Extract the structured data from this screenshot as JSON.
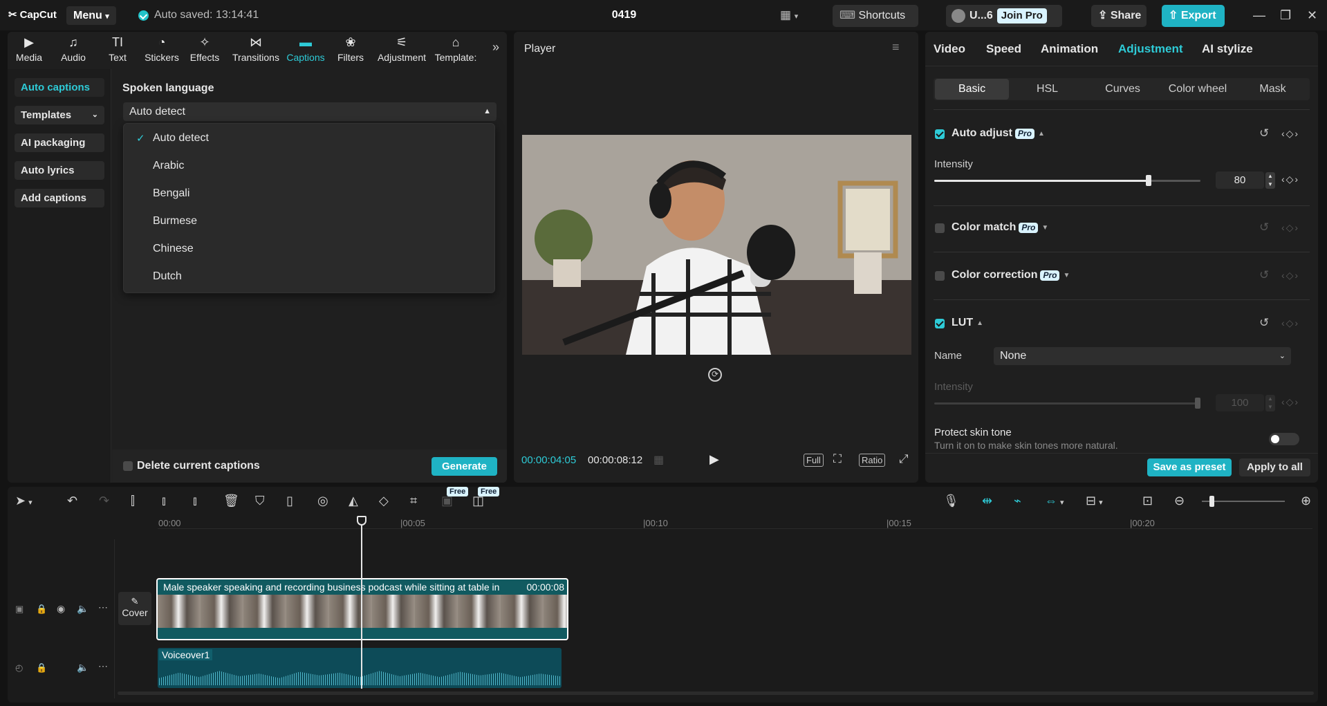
{
  "app": {
    "logo": "CapCut",
    "menu_label": "Menu",
    "autosave": "Auto saved: 13:14:41",
    "project_title": "0419"
  },
  "topbar": {
    "shortcuts": "Shortcuts",
    "user": "U...6",
    "join_pro": "Join Pro",
    "share": "Share",
    "export": "Export"
  },
  "tools": [
    {
      "label": "Media",
      "icon": "media-icon"
    },
    {
      "label": "Audio",
      "icon": "audio-icon"
    },
    {
      "label": "Text",
      "icon": "text-icon"
    },
    {
      "label": "Stickers",
      "icon": "stickers-icon"
    },
    {
      "label": "Effects",
      "icon": "effects-icon"
    },
    {
      "label": "Transitions",
      "icon": "transitions-icon"
    },
    {
      "label": "Captions",
      "icon": "captions-icon"
    },
    {
      "label": "Filters",
      "icon": "filters-icon"
    },
    {
      "label": "Adjustment",
      "icon": "adjustment-icon"
    },
    {
      "label": "Template:",
      "icon": "template-icon"
    }
  ],
  "left_nav": [
    "Auto captions",
    "Templates",
    "AI packaging",
    "Auto lyrics",
    "Add captions"
  ],
  "captions": {
    "spoken_language_label": "Spoken language",
    "selected": "Auto detect",
    "options": [
      "Auto detect",
      "Arabic",
      "Bengali",
      "Burmese",
      "Chinese",
      "Dutch"
    ],
    "delete_label": "Delete current captions",
    "generate": "Generate"
  },
  "player": {
    "title": "Player",
    "current_time": "00:00:04:05",
    "total_time": "00:00:08:12",
    "full": "Full",
    "ratio": "Ratio"
  },
  "right": {
    "tabs": [
      "Video",
      "Speed",
      "Animation",
      "Adjustment",
      "AI stylize"
    ],
    "subtabs": [
      "Basic",
      "HSL",
      "Curves",
      "Color wheel",
      "Mask"
    ],
    "auto_adjust": "Auto adjust",
    "pro": "Pro",
    "intensity": "Intensity",
    "intensity_value": "80",
    "color_match": "Color match",
    "color_correction": "Color correction",
    "lut": "LUT",
    "name_label": "Name",
    "name_value": "None",
    "lut_intensity": "Intensity",
    "lut_intensity_value": "100",
    "protect_title": "Protect skin tone",
    "protect_desc": "Turn it on to make skin tones more natural.",
    "save_preset": "Save as preset",
    "apply_all": "Apply to all"
  },
  "timeline": {
    "free_badge": "Free",
    "ruler": [
      "00:00",
      "|00:05",
      "|00:10",
      "|00:15",
      "|00:20"
    ],
    "cover": "Cover",
    "clip_title": "Male speaker speaking and recording business podcast while sitting at table in",
    "clip_duration": "00:00:08",
    "audio_title": "Voiceover1"
  }
}
